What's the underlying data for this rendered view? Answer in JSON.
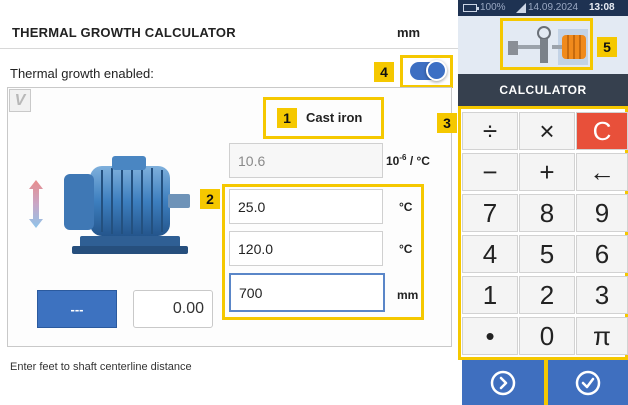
{
  "header": {
    "title": "THERMAL GROWTH CALCULATOR",
    "unit": "mm"
  },
  "thermal": {
    "enabled_label": "Thermal growth enabled:",
    "enabled": true
  },
  "material": {
    "label": "Cast iron"
  },
  "coefficient": {
    "value": "10.6",
    "unit_base": "10",
    "unit_exp": "-6",
    "unit_rest": " / °C"
  },
  "temperatures": {
    "t1": {
      "value": "25.0",
      "unit": "°C"
    },
    "t2": {
      "value": "120.0",
      "unit": "°C"
    },
    "distance": {
      "value": "700",
      "unit": "mm"
    }
  },
  "result": {
    "button_label": "---",
    "value": "0.00"
  },
  "hint": "Enter feet to shaft centerline distance",
  "view_badge": "V",
  "callouts": [
    "1",
    "2",
    "3",
    "4",
    "5"
  ],
  "status_bar": {
    "battery": "100%",
    "date": "14.09.2024",
    "time": "13:08"
  },
  "calculator": {
    "title": "CALCULATOR",
    "keys": [
      [
        "÷",
        "×",
        "C"
      ],
      [
        "−",
        "+",
        "←"
      ],
      [
        "7",
        "8",
        "9"
      ],
      [
        "4",
        "5",
        "6"
      ],
      [
        "1",
        "2",
        "3"
      ],
      [
        "•",
        "0",
        "π"
      ]
    ]
  },
  "icons": {
    "next": "chevron-right-circle-icon",
    "confirm": "checkmark-circle-icon",
    "temperature": "up-down-arrow-icon",
    "toggle": "toggle-switch-icon"
  },
  "colors": {
    "accent_blue": "#3d72c0",
    "callout_yellow": "#f5c800",
    "clear_red": "#e8503a",
    "header_dark": "#36404e",
    "status_bar": "#1e3252"
  }
}
